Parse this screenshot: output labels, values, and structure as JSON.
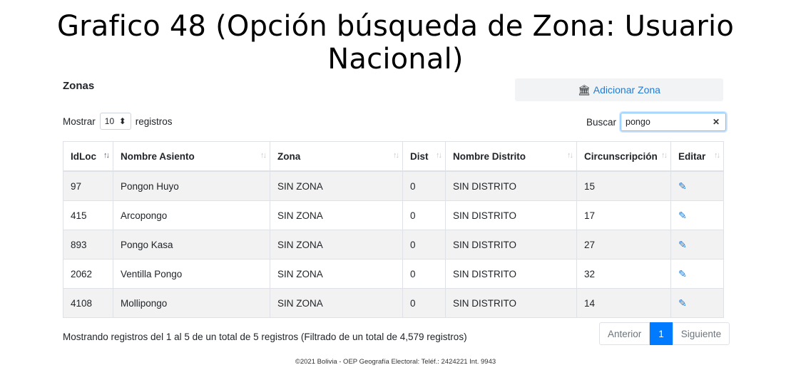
{
  "slide": {
    "title": "Grafico 48 (Opción búsqueda de Zona: Usuario Nacional)"
  },
  "page": {
    "title": "Zonas"
  },
  "add_button": {
    "icon": "bank-icon",
    "label": "Adicionar Zona"
  },
  "length_control": {
    "prefix": "Mostrar",
    "value": "10",
    "suffix": "registros"
  },
  "search": {
    "label": "Buscar",
    "value": "pongo"
  },
  "table": {
    "columns": [
      "IdLoc",
      "Nombre Asiento",
      "Zona",
      "Dist",
      "Nombre Distrito",
      "Circunscripción",
      "Editar"
    ],
    "rows": [
      [
        "97",
        "Pongon Huyo",
        "SIN ZONA",
        "0",
        "SIN DISTRITO",
        "15"
      ],
      [
        "415",
        "Arcopongo",
        "SIN ZONA",
        "0",
        "SIN DISTRITO",
        "17"
      ],
      [
        "893",
        "Pongo Kasa",
        "SIN ZONA",
        "0",
        "SIN DISTRITO",
        "27"
      ],
      [
        "2062",
        "Ventilla Pongo",
        "SIN ZONA",
        "0",
        "SIN DISTRITO",
        "32"
      ],
      [
        "4108",
        "Mollipongo",
        "SIN ZONA",
        "0",
        "SIN DISTRITO",
        "14"
      ]
    ],
    "edit_icon": "edit-icon"
  },
  "info": {
    "text": "Mostrando registros del 1 al 5 de un total de 5 registros (Filtrado de un total de 4,579 registros)"
  },
  "pagination": {
    "prev": "Anterior",
    "current": "1",
    "next": "Siguiente"
  },
  "footer": {
    "text": "©2021 Bolivia - OEP Geografía Electoral: Teléf.: 2424221 Int. 9943"
  },
  "colors": {
    "accent": "#007bff",
    "link": "#1e7bd8",
    "stripe": "#f2f2f2"
  }
}
